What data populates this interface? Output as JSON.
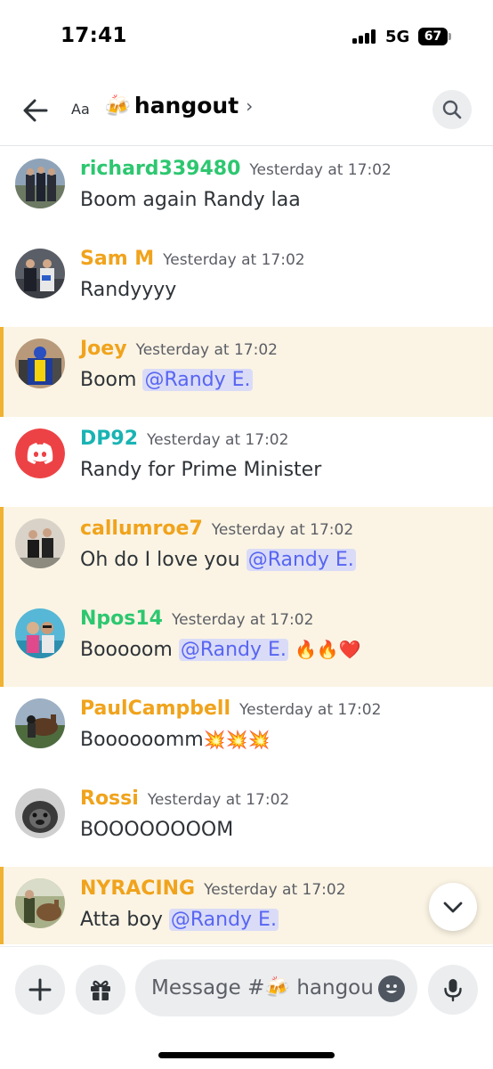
{
  "status_bar": {
    "time": "17:41",
    "network": "5G",
    "battery": "67"
  },
  "header": {
    "text_size_label": "Aa",
    "channel_emoji": "🍻",
    "channel_name": "hangout",
    "chevron": "›",
    "search_icon": "search-icon",
    "back_icon": "arrow-left-icon"
  },
  "messages": [
    {
      "author": "richard339480",
      "timestamp": "Yesterday at 17:02",
      "text": "Boom again Randy laa",
      "author_color": "#2dc770"
    },
    {
      "author": "Sam M",
      "timestamp": "Yesterday at 17:02",
      "text": "Randyyyy",
      "author_color": "#f0a31c"
    },
    {
      "author": "Joey",
      "timestamp": "Yesterday at 17:02",
      "text": "Boom",
      "mention": "@Randy E.",
      "author_color": "#f0a31c"
    },
    {
      "author": "DP92",
      "timestamp": "Yesterday at 17:02",
      "text": "Randy for Prime Minister",
      "author_color": "#1ab3b3"
    },
    {
      "author": "callumroe7",
      "timestamp": "Yesterday at 17:02",
      "text": "Oh do I love you",
      "mention": "@Randy E.",
      "author_color": "#f0a31c"
    },
    {
      "author": "Npos14",
      "timestamp": "Yesterday at 17:02",
      "text": "Booooom",
      "mention": "@Randy E.",
      "suffix": "🔥🔥❤️",
      "author_color": "#2dc770"
    },
    {
      "author": "PaulCampbell",
      "timestamp": "Yesterday at 17:02",
      "text": "Boooooomm",
      "suffix": "💥💥💥",
      "author_color": "#f0a31c"
    },
    {
      "author": "Rossi",
      "timestamp": "Yesterday at 17:02",
      "text": "BOOOOOOOOM",
      "author_color": "#f0a31c"
    },
    {
      "author": "NYRACING",
      "timestamp": "Yesterday at 17:02",
      "text": "Atta boy",
      "mention": "@Randy E.",
      "author_color": "#f0a31c"
    }
  ],
  "composer": {
    "placeholder": "Message #🍻 hangout",
    "icons": [
      "plus-icon",
      "gift-icon",
      "emoji-icon",
      "microphone-icon"
    ]
  },
  "colors": {
    "mention_bg": "#dadcf7",
    "mention_text": "#5865f2",
    "highlight_bg": "#fbf4e4",
    "highlight_border": "#f0b232",
    "discord_red": "#ed4245"
  }
}
